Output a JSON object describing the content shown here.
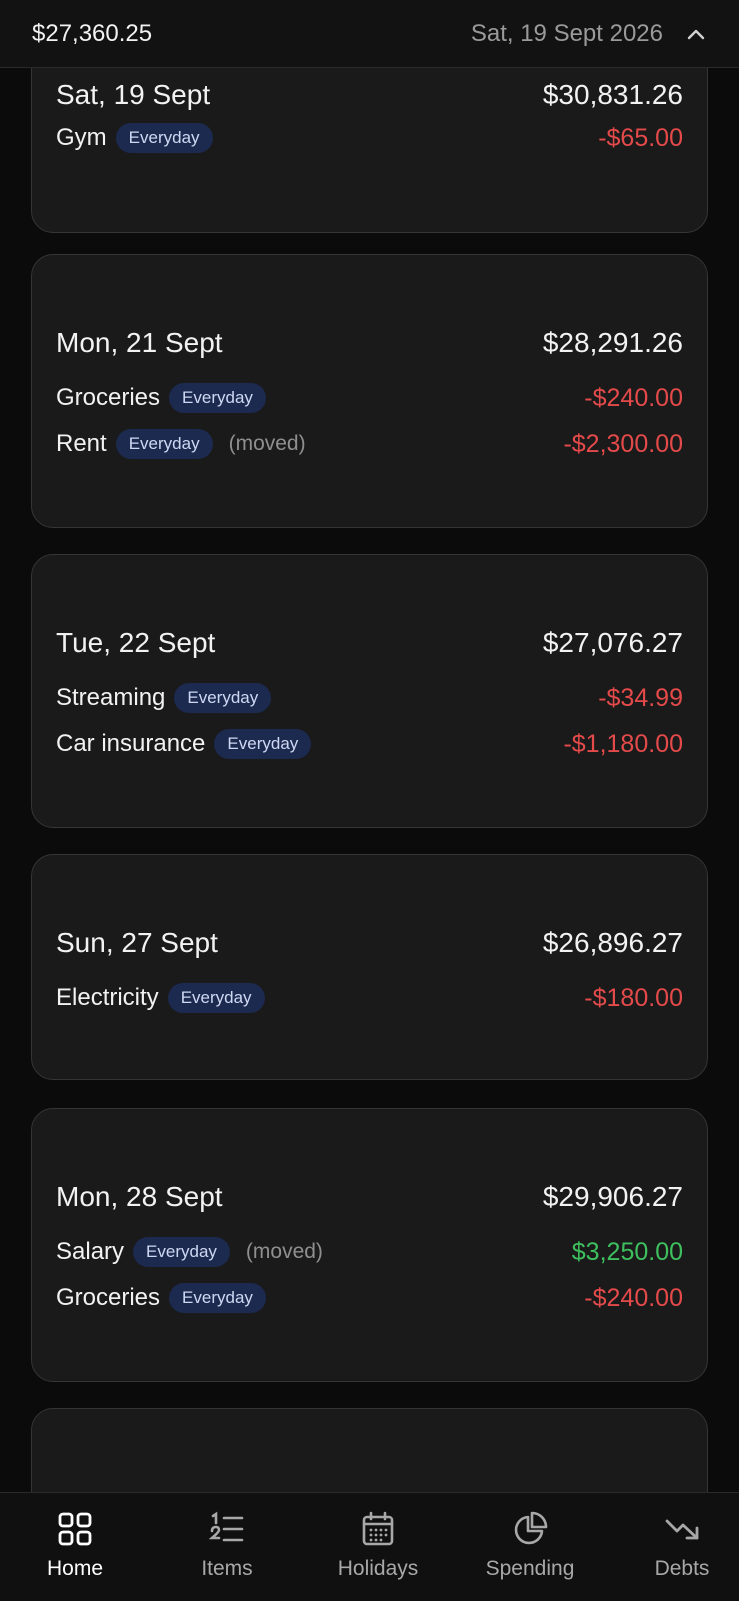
{
  "header": {
    "balance": "$27,360.25",
    "date": "Sat, 19 Sept 2026",
    "collapse_icon": "chevron-up-icon"
  },
  "days": [
    {
      "date": "Sat, 19 Sept",
      "balance": "$30,831.26",
      "items": [
        {
          "name": "Gym",
          "badge": "Everyday",
          "note": "",
          "amount": "-$65.00",
          "kind": "neg"
        }
      ]
    },
    {
      "date": "Mon, 21 Sept",
      "balance": "$28,291.26",
      "items": [
        {
          "name": "Groceries",
          "badge": "Everyday",
          "note": "",
          "amount": "-$240.00",
          "kind": "neg"
        },
        {
          "name": "Rent",
          "badge": "Everyday",
          "note": "(moved)",
          "amount": "-$2,300.00",
          "kind": "neg"
        }
      ]
    },
    {
      "date": "Tue, 22 Sept",
      "balance": "$27,076.27",
      "items": [
        {
          "name": "Streaming",
          "badge": "Everyday",
          "note": "",
          "amount": "-$34.99",
          "kind": "neg"
        },
        {
          "name": "Car insurance",
          "badge": "Everyday",
          "note": "",
          "amount": "-$1,180.00",
          "kind": "neg"
        }
      ]
    },
    {
      "date": "Sun, 27 Sept",
      "balance": "$26,896.27",
      "items": [
        {
          "name": "Electricity",
          "badge": "Everyday",
          "note": "",
          "amount": "-$180.00",
          "kind": "neg"
        }
      ]
    },
    {
      "date": "Mon, 28 Sept",
      "balance": "$29,906.27",
      "items": [
        {
          "name": "Salary",
          "badge": "Everyday",
          "note": "(moved)",
          "amount": "$3,250.00",
          "kind": "pos"
        },
        {
          "name": "Groceries",
          "badge": "Everyday",
          "note": "",
          "amount": "-$240.00",
          "kind": "neg"
        }
      ]
    }
  ],
  "tabs": [
    {
      "label": "Home",
      "icon": "home-grid-icon",
      "active": true
    },
    {
      "label": "Items",
      "icon": "numbered-list-icon",
      "active": false
    },
    {
      "label": "Holidays",
      "icon": "calendar-icon",
      "active": false
    },
    {
      "label": "Spending",
      "icon": "pie-chart-icon",
      "active": false
    },
    {
      "label": "Debts",
      "icon": "trending-down-icon",
      "active": false
    }
  ],
  "colors": {
    "negative": "#e44a4a",
    "positive": "#3ec05e",
    "badge_bg": "#1c2a4f"
  }
}
